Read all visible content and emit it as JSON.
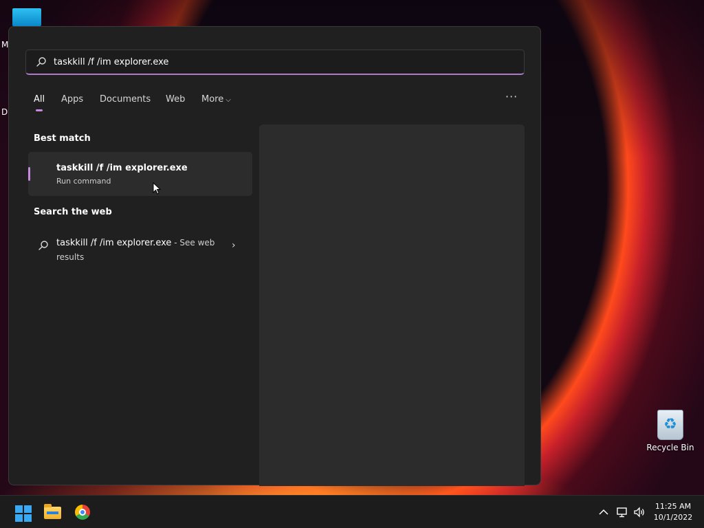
{
  "desktop": {
    "edge_letters": [
      "M",
      "D"
    ],
    "recycle_bin_label": "Recycle Bin"
  },
  "search": {
    "query": "taskkill /f /im explorer.exe",
    "icon": "search-icon"
  },
  "tabs": [
    {
      "label": "All",
      "active": true
    },
    {
      "label": "Apps"
    },
    {
      "label": "Documents"
    },
    {
      "label": "Web"
    },
    {
      "label": "More"
    }
  ],
  "more_options_icon": "ellipsis-icon",
  "best_match": {
    "heading": "Best match",
    "title": "taskkill /f /im explorer.exe",
    "subtitle": "Run command"
  },
  "web_search": {
    "heading": "Search the web",
    "query": "taskkill /f /im explorer.exe",
    "suffix": " - See web results"
  },
  "taskbar": {
    "apps": [
      "start-icon",
      "file-explorer-icon",
      "chrome-icon"
    ],
    "tray": [
      "chevron-up-icon",
      "network-icon",
      "volume-icon"
    ],
    "time": "11:25 AM",
    "date": "10/1/2022"
  },
  "colors": {
    "accent": "#c589e0",
    "panel": "#202020",
    "card": "#2c2c2c",
    "taskbar": "#1c1c1c"
  }
}
